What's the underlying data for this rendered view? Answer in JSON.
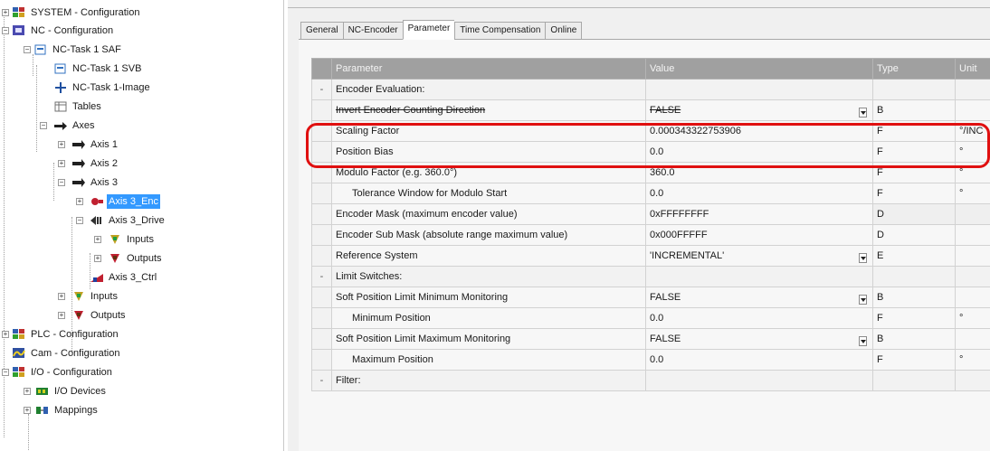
{
  "tree": {
    "items": [
      {
        "label": "SYSTEM - Configuration",
        "icon": "system-config-icon"
      },
      {
        "label": "NC - Configuration",
        "icon": "nc-config-icon"
      },
      {
        "label": "NC-Task 1 SAF",
        "icon": "task-icon"
      },
      {
        "label": "NC-Task 1 SVB",
        "icon": "task-icon"
      },
      {
        "label": "NC-Task 1-Image",
        "icon": "image-icon"
      },
      {
        "label": "Tables",
        "icon": "table-icon"
      },
      {
        "label": "Axes",
        "icon": "axes-icon"
      },
      {
        "label": "Axis 1",
        "icon": "axis-icon"
      },
      {
        "label": "Axis 2",
        "icon": "axis-icon"
      },
      {
        "label": "Axis 3",
        "icon": "axis-icon"
      },
      {
        "label": "Axis 3_Enc",
        "icon": "encoder-icon"
      },
      {
        "label": "Axis 3_Drive",
        "icon": "drive-icon"
      },
      {
        "label": "Inputs",
        "icon": "inputs-icon"
      },
      {
        "label": "Outputs",
        "icon": "outputs-icon"
      },
      {
        "label": "Axis 3_Ctrl",
        "icon": "controller-icon"
      },
      {
        "label": "Inputs",
        "icon": "inputs-icon"
      },
      {
        "label": "Outputs",
        "icon": "outputs-icon"
      },
      {
        "label": "PLC - Configuration",
        "icon": "plc-config-icon"
      },
      {
        "label": "Cam - Configuration",
        "icon": "cam-config-icon"
      },
      {
        "label": "I/O - Configuration",
        "icon": "io-config-icon"
      },
      {
        "label": "I/O Devices",
        "icon": "io-devices-icon"
      },
      {
        "label": "Mappings",
        "icon": "mappings-icon"
      }
    ],
    "selected": "Axis 3_Enc"
  },
  "tabs": [
    "General",
    "NC-Encoder",
    "Parameter",
    "Time Compensation",
    "Online"
  ],
  "active_tab": "Parameter",
  "grid": {
    "headers": [
      "Parameter",
      "Value",
      "Type",
      "Unit"
    ],
    "rows": [
      {
        "kind": "section",
        "marker": "-",
        "name": "Encoder Evaluation:"
      },
      {
        "name": "Invert Encoder Counting Direction",
        "value": "FALSE",
        "type": "B",
        "unit": "",
        "dropdown": true
      },
      {
        "name": "Scaling Factor",
        "value": "0.000343322753906",
        "type": "F",
        "unit": "°/INC"
      },
      {
        "name": "Position Bias",
        "value": "0.0",
        "type": "F",
        "unit": "°"
      },
      {
        "name": "Modulo Factor (e.g. 360.0°)",
        "value": "360.0",
        "type": "F",
        "unit": "°"
      },
      {
        "name": "Tolerance Window for Modulo Start",
        "value": "0.0",
        "type": "F",
        "unit": "°",
        "indent": true
      },
      {
        "name": "Encoder Mask (maximum encoder value)",
        "value": "0xFFFFFFFF",
        "type": "D",
        "unit": ""
      },
      {
        "name": "Encoder Sub Mask (absolute range maximum value)",
        "value": "0x000FFFFF",
        "type": "D",
        "unit": ""
      },
      {
        "name": "Reference System",
        "value": "'INCREMENTAL'",
        "type": "E",
        "unit": "",
        "dropdown": true
      },
      {
        "kind": "section",
        "marker": "-",
        "name": "Limit Switches:"
      },
      {
        "name": "Soft Position Limit Minimum Monitoring",
        "value": "FALSE",
        "type": "B",
        "unit": "",
        "dropdown": true
      },
      {
        "name": "Minimum Position",
        "value": "0.0",
        "type": "F",
        "unit": "°",
        "indent": true
      },
      {
        "name": "Soft Position Limit Maximum Monitoring",
        "value": "FALSE",
        "type": "B",
        "unit": "",
        "dropdown": true
      },
      {
        "name": "Maximum Position",
        "value": "0.0",
        "type": "F",
        "unit": "°",
        "indent": true
      },
      {
        "kind": "section",
        "marker": "-",
        "name": "Filter:"
      }
    ]
  },
  "colors": {
    "selection": "#3399ff",
    "highlight": "#e01010",
    "header": "#a0a0a0"
  }
}
